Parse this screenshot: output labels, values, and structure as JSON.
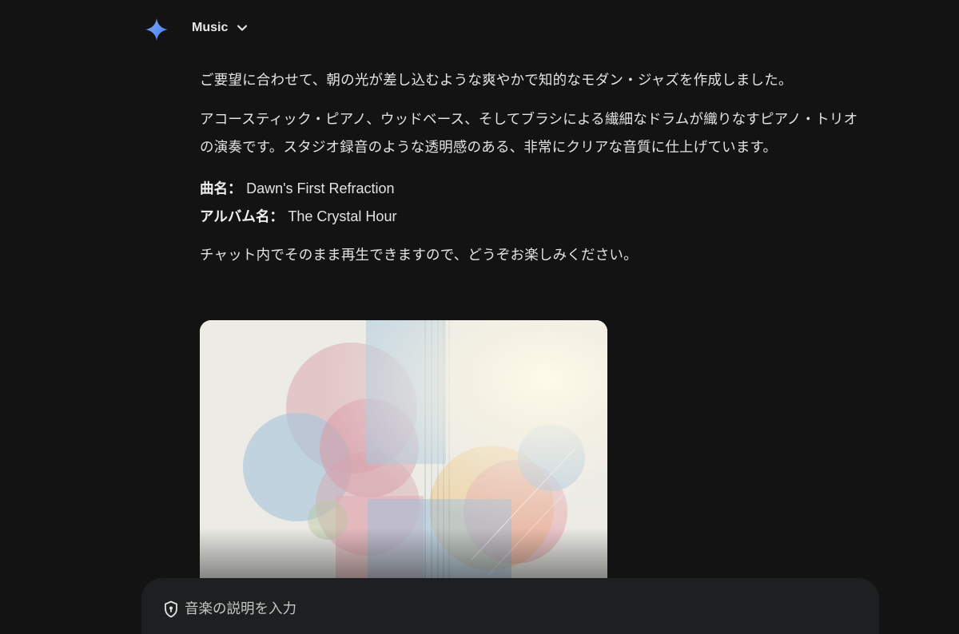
{
  "header": {
    "model_label": "Music"
  },
  "message": {
    "intro": "ご要望に合わせて、朝の光が差し込むような爽やかで知的なモダン・ジャズを作成しました。",
    "description": "アコースティック・ピアノ、ウッドベース、そしてブラシによる繊細なドラムが織りなすピアノ・トリオの演奏です。スタジオ録音のような透明感のある、非常にクリアな音質に仕上げています。",
    "song_key": "曲名：",
    "song_title": "Dawn's First Refraction",
    "album_key": "アルバム名：",
    "album_title": "The Crystal Hour",
    "closing": "チャット内でそのまま再生できますので、どうぞお楽しみください。"
  },
  "composer": {
    "placeholder": "音楽の説明を入力"
  },
  "icons": {
    "spark": "gemini-spark-icon",
    "chevron": "chevron-down-icon",
    "shield": "shield-icon"
  },
  "colors": {
    "background": "#131314",
    "composer": "#1e1f20",
    "spark": "#5b8def"
  }
}
